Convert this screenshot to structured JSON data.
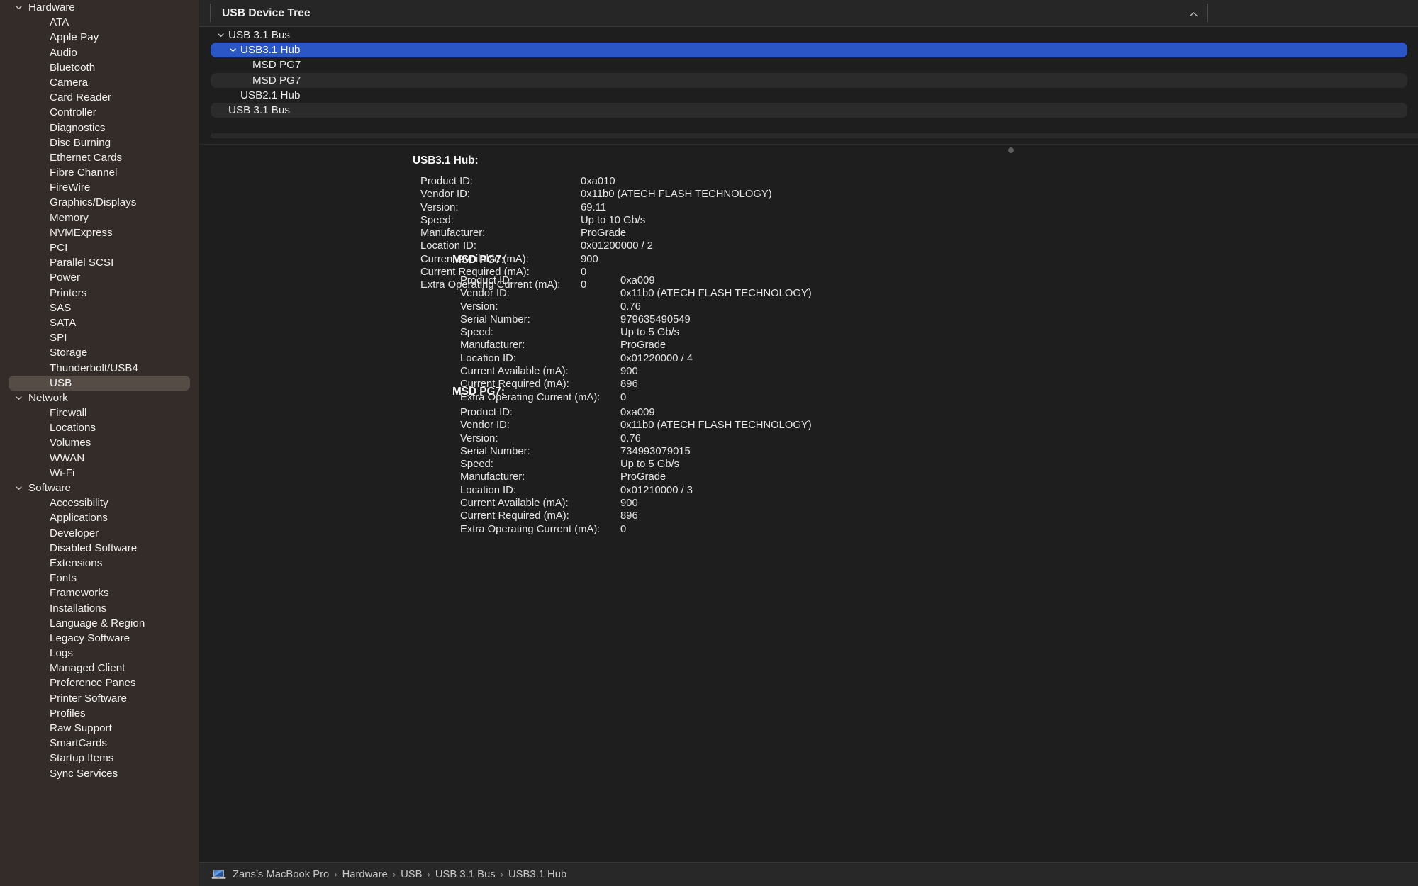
{
  "sidebar": {
    "groups": [
      {
        "label": "Hardware",
        "expanded": true,
        "items": [
          "ATA",
          "Apple Pay",
          "Audio",
          "Bluetooth",
          "Camera",
          "Card Reader",
          "Controller",
          "Diagnostics",
          "Disc Burning",
          "Ethernet Cards",
          "Fibre Channel",
          "FireWire",
          "Graphics/Displays",
          "Memory",
          "NVMExpress",
          "PCI",
          "Parallel SCSI",
          "Power",
          "Printers",
          "SAS",
          "SATA",
          "SPI",
          "Storage",
          "Thunderbolt/USB4",
          "USB"
        ],
        "selected": "USB"
      },
      {
        "label": "Network",
        "expanded": true,
        "items": [
          "Firewall",
          "Locations",
          "Volumes",
          "WWAN",
          "Wi-Fi"
        ],
        "selected": null
      },
      {
        "label": "Software",
        "expanded": true,
        "items": [
          "Accessibility",
          "Applications",
          "Developer",
          "Disabled Software",
          "Extensions",
          "Fonts",
          "Frameworks",
          "Installations",
          "Language & Region",
          "Legacy Software",
          "Logs",
          "Managed Client",
          "Preference Panes",
          "Printer Software",
          "Profiles",
          "Raw Support",
          "SmartCards",
          "Startup Items",
          "Sync Services"
        ],
        "selected": null
      }
    ]
  },
  "tree_header": {
    "title": "USB Device Tree",
    "sort_indicator": "ascending-chevron"
  },
  "tree_rows": [
    {
      "label": "USB 3.1 Bus",
      "level": 0,
      "twisty": "expanded",
      "selected": false,
      "alt": false
    },
    {
      "label": "USB3.1 Hub",
      "level": 1,
      "twisty": "expanded",
      "selected": true,
      "alt": true
    },
    {
      "label": "MSD PG7",
      "level": 2,
      "twisty": "none",
      "selected": false,
      "alt": false
    },
    {
      "label": "MSD PG7",
      "level": 2,
      "twisty": "none",
      "selected": false,
      "alt": true
    },
    {
      "label": "USB2.1 Hub",
      "level": 1,
      "twisty": "none",
      "selected": false,
      "alt": false
    },
    {
      "label": "USB 3.1 Bus",
      "level": 0,
      "twisty": "none",
      "selected": false,
      "alt": true
    }
  ],
  "detail": {
    "root": {
      "title": "USB3.1 Hub:",
      "rows": [
        {
          "key": "Product ID:",
          "value": "0xa010"
        },
        {
          "key": "Vendor ID:",
          "value": "0x11b0   (ATECH FLASH TECHNOLOGY)"
        },
        {
          "key": "Version:",
          "value": "69.11"
        },
        {
          "key": "Speed:",
          "value": "Up to 10 Gb/s"
        },
        {
          "key": "Manufacturer:",
          "value": "ProGrade"
        },
        {
          "key": "Location ID:",
          "value": "0x01200000 / 2"
        },
        {
          "key": "Current Available (mA):",
          "value": "900"
        },
        {
          "key": "Current Required (mA):",
          "value": "0"
        },
        {
          "key": "Extra Operating Current (mA):",
          "value": "0"
        }
      ]
    },
    "children": [
      {
        "title": "MSD PG7:",
        "rows": [
          {
            "key": "Product ID:",
            "value": "0xa009"
          },
          {
            "key": "Vendor ID:",
            "value": "0x11b0   (ATECH FLASH TECHNOLOGY)"
          },
          {
            "key": "Version:",
            "value": "0.76"
          },
          {
            "key": "Serial Number:",
            "value": "979635490549"
          },
          {
            "key": "Speed:",
            "value": "Up to 5 Gb/s"
          },
          {
            "key": "Manufacturer:",
            "value": "ProGrade"
          },
          {
            "key": "Location ID:",
            "value": "0x01220000 / 4"
          },
          {
            "key": "Current Available (mA):",
            "value": "900"
          },
          {
            "key": "Current Required (mA):",
            "value": "896"
          },
          {
            "key": "Extra Operating Current (mA):",
            "value": "0"
          }
        ]
      },
      {
        "title": "MSD PG7:",
        "rows": [
          {
            "key": "Product ID:",
            "value": "0xa009"
          },
          {
            "key": "Vendor ID:",
            "value": "0x11b0   (ATECH FLASH TECHNOLOGY)"
          },
          {
            "key": "Version:",
            "value": "0.76"
          },
          {
            "key": "Serial Number:",
            "value": "734993079015"
          },
          {
            "key": "Speed:",
            "value": "Up to 5 Gb/s"
          },
          {
            "key": "Manufacturer:",
            "value": "ProGrade"
          },
          {
            "key": "Location ID:",
            "value": "0x01210000 / 3"
          },
          {
            "key": "Current Available (mA):",
            "value": "900"
          },
          {
            "key": "Current Required (mA):",
            "value": "896"
          },
          {
            "key": "Extra Operating Current (mA):",
            "value": "0"
          }
        ]
      }
    ]
  },
  "breadcrumb": {
    "icon": "macbook-pro-icon",
    "separator": "›",
    "items": [
      "Zans’s MacBook Pro",
      "Hardware",
      "USB",
      "USB 3.1 Bus",
      "USB3.1 Hub"
    ]
  },
  "colors": {
    "sidebar_bg": "#332c28",
    "content_bg": "#1e1e1e",
    "selection_blue": "#2a56c6",
    "row_alt": "#2b2b2b",
    "sidebar_selection": "#554c46",
    "header_bg": "#262626",
    "bottom_bar_bg": "#282828"
  }
}
